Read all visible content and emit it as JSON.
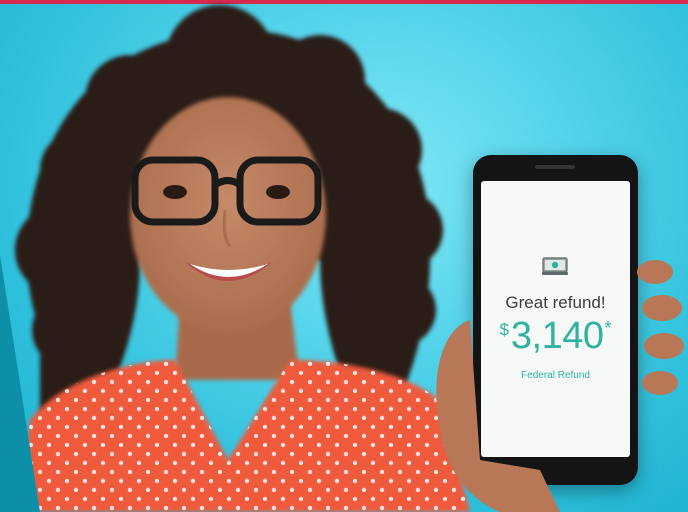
{
  "colors": {
    "top_strip": "#d62a4e",
    "background": "#3ec8e2",
    "refund_green": "#2db39e",
    "shirt": "#ef5a3c",
    "phone_body": "#141414"
  },
  "phone": {
    "icon": "money-icon",
    "headline": "Great refund!",
    "currency_symbol": "$",
    "amount": "3,140",
    "amount_note_mark": "*",
    "caption": "Federal Refund"
  }
}
